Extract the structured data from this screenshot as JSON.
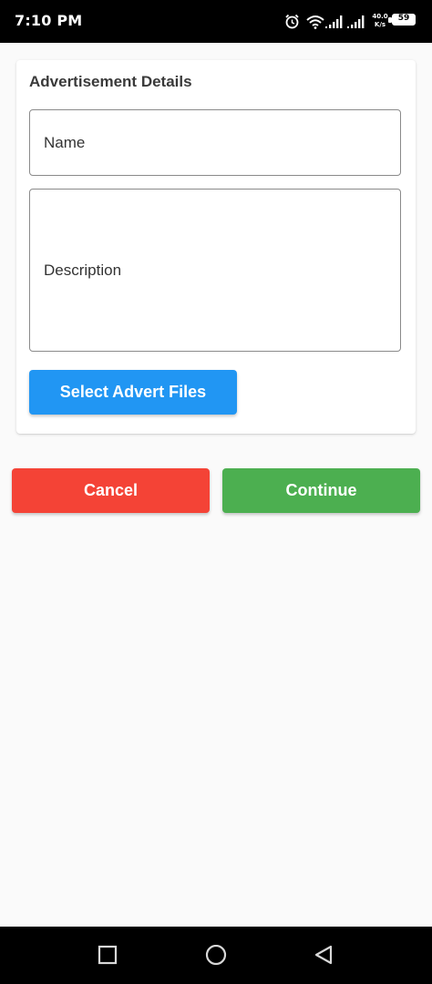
{
  "status_bar": {
    "time": "7:10 PM",
    "net_speed_value": "40.0",
    "net_speed_unit": "K/s",
    "battery": "59",
    "battery_level": 0.59,
    "icons": [
      "alarm-icon",
      "wifi-icon",
      "signal-icon",
      "signal-icon-2"
    ]
  },
  "card": {
    "title": "Advertisement Details",
    "name_field": {
      "placeholder": "Name",
      "value": ""
    },
    "description_field": {
      "placeholder": "Description",
      "value": ""
    },
    "select_files_label": "Select Advert Files"
  },
  "actions": {
    "cancel_label": "Cancel",
    "continue_label": "Continue"
  },
  "nav_bar": {
    "icons": [
      "recent-apps-icon",
      "home-icon",
      "back-icon"
    ]
  },
  "colors": {
    "select_button": "#2196f3",
    "cancel_button": "#f44336",
    "continue_button": "#4caf50",
    "background": "#fafafa"
  }
}
